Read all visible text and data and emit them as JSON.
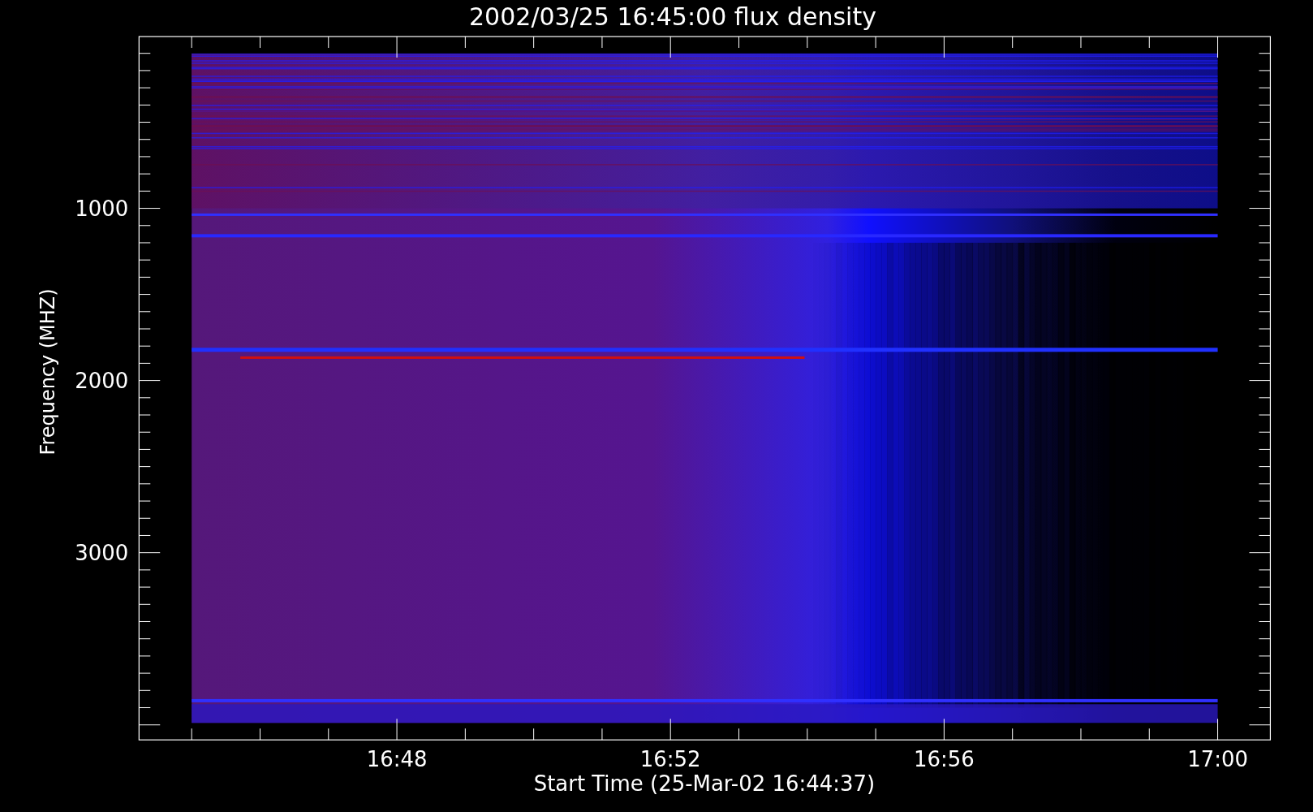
{
  "title": "2002/03/25 16:45:00 flux density",
  "y_axis": {
    "label": "Frequency (MHZ)",
    "ticks": [
      {
        "label": "1000"
      },
      {
        "label": "2000"
      },
      {
        "label": "3000"
      }
    ]
  },
  "x_axis": {
    "label": "Start Time (25-Mar-02 16:44:37)",
    "ticks": [
      {
        "label": "16:48"
      },
      {
        "label": "16:52"
      },
      {
        "label": "16:56"
      },
      {
        "label": "17:00"
      }
    ]
  }
}
